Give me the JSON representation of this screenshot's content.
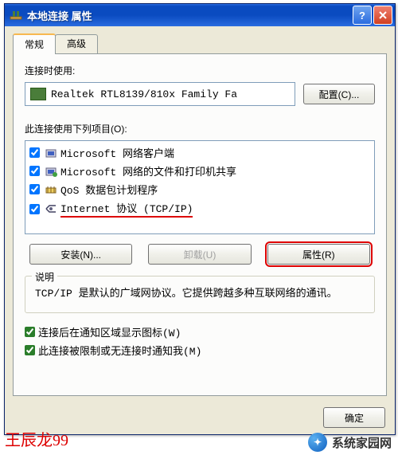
{
  "window": {
    "title": "本地连接 属性"
  },
  "tabs": [
    {
      "label": "常规",
      "active": true
    },
    {
      "label": "高级",
      "active": false
    }
  ],
  "connect_using_label": "连接时使用:",
  "adapter": {
    "name": "Realtek RTL8139/810x Family Fa"
  },
  "configure_btn": "配置(C)...",
  "items_label": "此连接使用下列项目(O):",
  "items": [
    {
      "checked": true,
      "icon": "client-icon",
      "label": "Microsoft 网络客户端"
    },
    {
      "checked": true,
      "icon": "share-icon",
      "label": "Microsoft 网络的文件和打印机共享"
    },
    {
      "checked": true,
      "icon": "qos-icon",
      "label": "QoS 数据包计划程序"
    },
    {
      "checked": true,
      "icon": "protocol-icon",
      "label": "Internet 协议 (TCP/IP)",
      "highlighted": true
    }
  ],
  "buttons": {
    "install": "安装(N)...",
    "uninstall": "卸载(U)",
    "properties": "属性(R)"
  },
  "description": {
    "legend": "说明",
    "text": "TCP/IP 是默认的广域网协议。它提供跨越多种互联网络的通讯。"
  },
  "checkboxes": {
    "show_icon": "连接后在通知区域显示图标(W)",
    "notify_limited": "此连接被限制或无连接时通知我(M)"
  },
  "ok_btn": "确定",
  "watermark_left": "王辰龙99",
  "watermark_right": "系统家园网"
}
